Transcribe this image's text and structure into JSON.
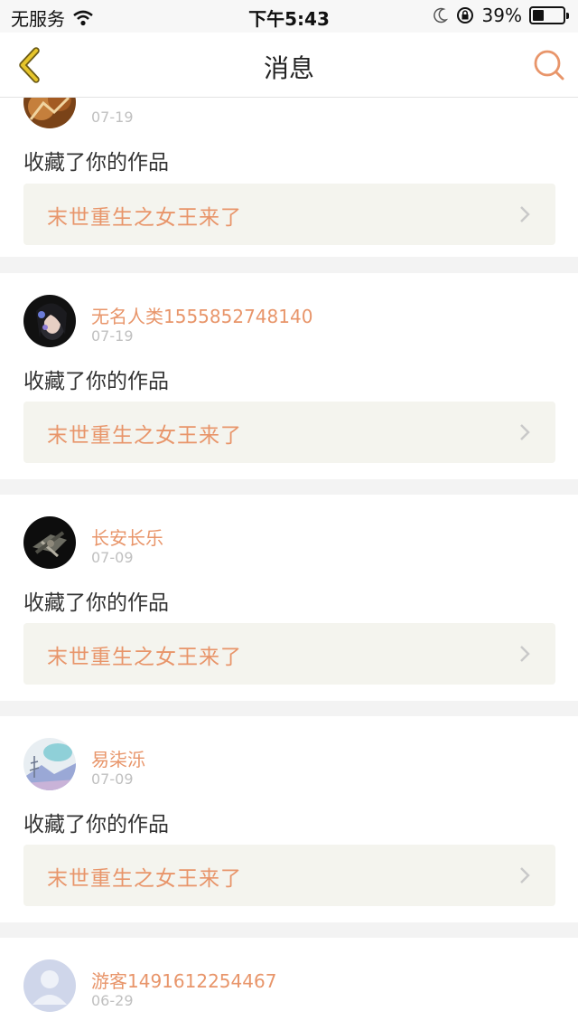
{
  "status_bar": {
    "carrier": "无服务",
    "time": "下午5:43",
    "battery_percent": "39%",
    "battery_level": 0.39,
    "icons": [
      "wifi-icon",
      "moon-icon",
      "orientation-lock-icon",
      "battery-icon"
    ]
  },
  "navbar": {
    "title": "消息",
    "back_icon": "chevron-left-icon",
    "search_icon": "search-icon"
  },
  "colors": {
    "accent": "#e8956a",
    "back_icon": "#d9b81f",
    "card_bg": "#ffffff",
    "page_bg": "#f3f3f3",
    "work_bg": "#f4f4ee"
  },
  "messages": [
    {
      "username": "",
      "date": "07-19",
      "action": "收藏了你的作品",
      "work_title": "末世重生之女王来了"
    },
    {
      "username": "无名人类1555852748140",
      "date": "07-19",
      "action": "收藏了你的作品",
      "work_title": "末世重生之女王来了"
    },
    {
      "username": "长安长乐",
      "date": "07-09",
      "action": "收藏了你的作品",
      "work_title": "末世重生之女王来了"
    },
    {
      "username": "易柒泺",
      "date": "07-09",
      "action": "收藏了你的作品",
      "work_title": "末世重生之女王来了"
    },
    {
      "username": "游客1491612254467",
      "date": "06-29"
    }
  ]
}
